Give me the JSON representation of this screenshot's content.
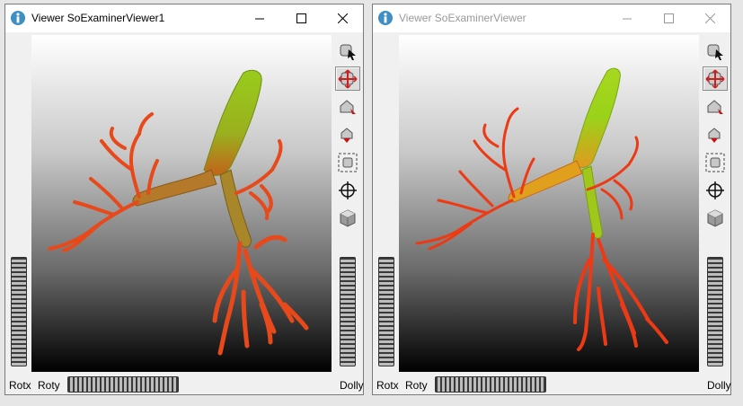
{
  "windows": [
    {
      "title": "Viewer SoExaminerViewer1",
      "active": true,
      "labels": {
        "rotx": "Rotx",
        "roty": "Roty",
        "dolly": "Dolly"
      },
      "tools": [
        "select-pointer-icon",
        "view-rotate-icon",
        "home-icon",
        "set-home-icon",
        "view-all-icon",
        "seek-icon",
        "projection-cube-icon"
      ],
      "active_tool": 1
    },
    {
      "title": "Viewer SoExaminerViewer",
      "active": false,
      "labels": {
        "rotx": "Rotx",
        "roty": "Roty",
        "dolly": "Dolly"
      },
      "tools": [
        "select-pointer-icon",
        "view-rotate-icon",
        "home-icon",
        "set-home-icon",
        "view-all-icon",
        "seek-icon",
        "projection-cube-icon"
      ],
      "active_tool": 1
    }
  ],
  "colors": {
    "accent_active_title": "#000000",
    "inactive_title": "#999999",
    "mesh_green": "#8fc21f",
    "mesh_red": "#e83a12"
  }
}
